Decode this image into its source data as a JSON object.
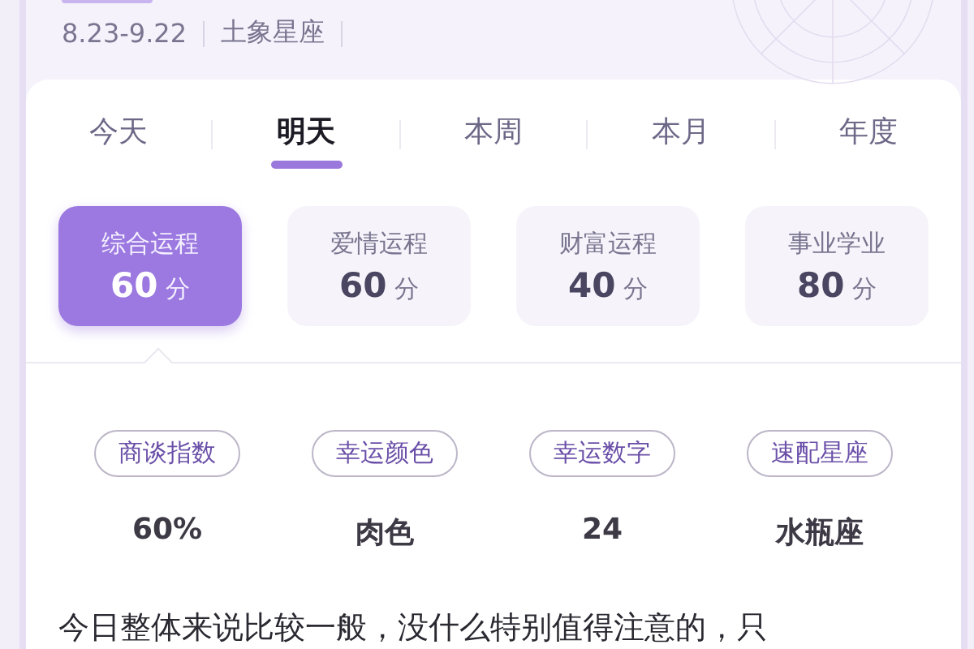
{
  "header": {
    "date_range": "8.23-9.22",
    "element": "土象星座"
  },
  "tabs": [
    {
      "label": "今天",
      "selected": false
    },
    {
      "label": "明天",
      "selected": true
    },
    {
      "label": "本周",
      "selected": false
    },
    {
      "label": "本月",
      "selected": false
    },
    {
      "label": "年度",
      "selected": false
    }
  ],
  "categories": [
    {
      "label": "综合运程",
      "score": "60",
      "unit": "分",
      "selected": true
    },
    {
      "label": "爱情运程",
      "score": "60",
      "unit": "分",
      "selected": false
    },
    {
      "label": "财富运程",
      "score": "40",
      "unit": "分",
      "selected": false
    },
    {
      "label": "事业学业",
      "score": "80",
      "unit": "分",
      "selected": false
    }
  ],
  "indicators": [
    {
      "label": "商谈指数",
      "value": "60%"
    },
    {
      "label": "幸运颜色",
      "value": "肉色"
    },
    {
      "label": "幸运数字",
      "value": "24"
    },
    {
      "label": "速配星座",
      "value": "水瓶座"
    }
  ],
  "description": "今日整体来说比较一般，没什么特别值得注意的，只"
}
